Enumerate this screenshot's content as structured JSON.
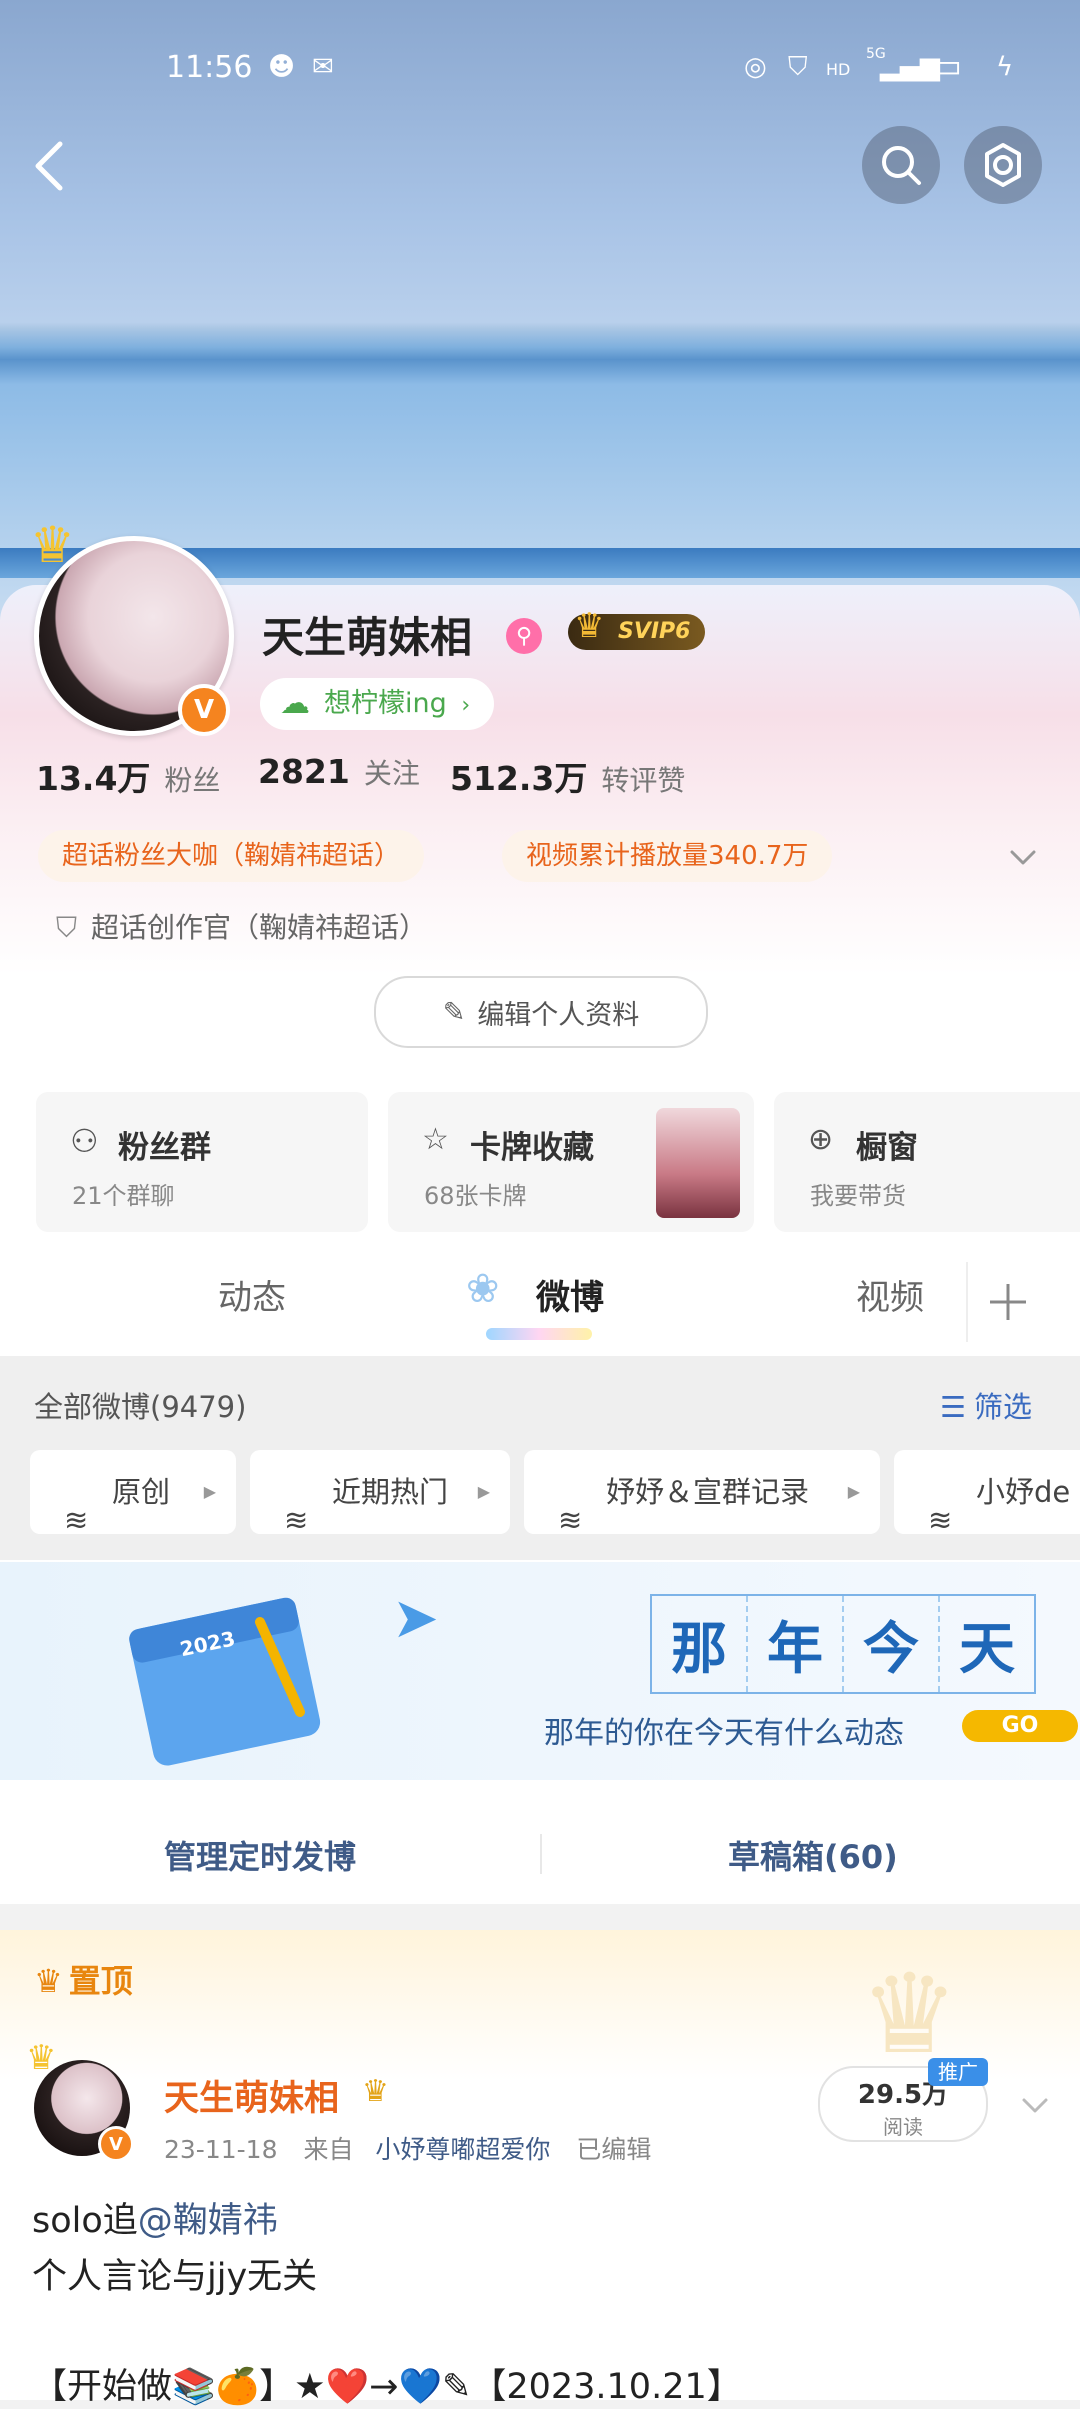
{
  "status_bar": {
    "time": "11:56",
    "network": "5G"
  },
  "profile": {
    "name": "天生萌妹相",
    "svip": "SVIP6",
    "mood": "想柠檬ing",
    "v_badge": "V",
    "stats": [
      {
        "value": "13.4万",
        "label": "粉丝"
      },
      {
        "value": "2821",
        "label": "关注"
      },
      {
        "value": "512.3万",
        "label": "转评赞"
      }
    ],
    "tags": [
      "超话粉丝大咖（鞠婧祎超话）",
      "视频累计播放量340.7万"
    ],
    "creator": "超话创作官（鞠婧祎超话）",
    "edit_button": "编辑个人资料"
  },
  "features": [
    {
      "title": "粉丝群",
      "sub": "21个群聊"
    },
    {
      "title": "卡牌收藏",
      "sub": "68张卡牌"
    },
    {
      "title": "橱窗",
      "sub": "我要带货"
    }
  ],
  "tabs": [
    "动态",
    "微博",
    "视频"
  ],
  "filter": {
    "title": "全部微博(9479)",
    "link": "筛选",
    "chips": [
      "原创",
      "近期热门",
      "妤妤＆宣群记录",
      "小妤de"
    ]
  },
  "banner": {
    "title_chars": [
      "那",
      "年",
      "今",
      "天"
    ],
    "calendar_year": "2023",
    "subtitle": "那年的你在今天有什么动态",
    "go": "GO"
  },
  "manage": {
    "scheduled": "管理定时发博",
    "drafts": "草稿箱(60)"
  },
  "pinned": {
    "label": "置顶",
    "author": "天生萌妹相",
    "date": "23-11-18",
    "from_prefix": "来自",
    "source": "小妤尊嘟超爱你",
    "edited": "已编辑",
    "reads": "29.5万",
    "reads_label": "阅读",
    "promo": "推广",
    "line1_prefix": "solo追",
    "line1_mention": "@鞠婧祎",
    "line2": "个人言论与jjy无关",
    "line3": "【开始做📚🍊】★❤️→💙✎【2023.10.21】"
  }
}
